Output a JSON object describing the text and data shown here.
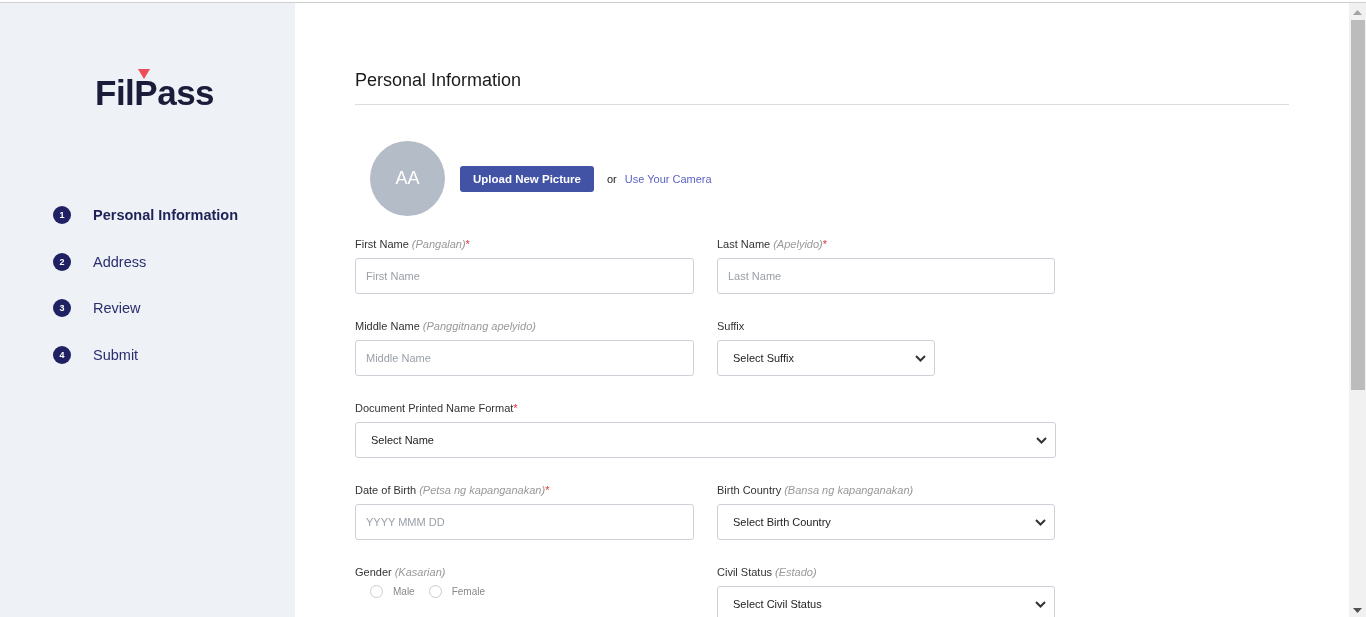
{
  "sidebar": {
    "logo": "FilPass",
    "steps": [
      {
        "number": "1",
        "label": "Personal Information",
        "selected": true
      },
      {
        "number": "2",
        "label": "Address",
        "selected": false
      },
      {
        "number": "3",
        "label": "Review",
        "selected": false
      },
      {
        "number": "4",
        "label": "Submit",
        "selected": false
      }
    ]
  },
  "form": {
    "title": "Personal Information",
    "avatar": {
      "initials": "AA"
    },
    "upload_button": "Upload New Picture",
    "or_text": "or",
    "camera_link": "Use Your Camera",
    "rows": [
      {
        "fields": [
          {
            "kind": "text",
            "label": "First Name",
            "hint": "(Pangalan)",
            "required_mark": "*",
            "placeholder": "First Name"
          },
          {
            "kind": "text",
            "label": "Last Name",
            "hint": "(Apelyido)",
            "required_mark": "*",
            "placeholder": "Last Name"
          }
        ]
      },
      {
        "fields": [
          {
            "kind": "text",
            "label": "Middle Name",
            "hint": "(Panggitnang apelyido)",
            "placeholder": "Middle Name"
          },
          {
            "kind": "select",
            "label": "Suffix",
            "value": "Select Suffix"
          }
        ]
      },
      {
        "fields": [
          {
            "kind": "select",
            "label": "Document Printed Name Format",
            "required_mark": "*",
            "value": "Select Name"
          }
        ]
      },
      {
        "fields": [
          {
            "kind": "text",
            "label": "Date of Birth",
            "hint": "(Petsa ng kapanganakan)",
            "required_mark": "*",
            "placeholder": "YYYY MMM DD"
          },
          {
            "kind": "select",
            "label": "Birth Country",
            "hint": "(Bansa ng kapanganakan)",
            "value": "Select Birth Country"
          }
        ]
      },
      {
        "fields": [
          {
            "kind": "radio",
            "label": "Gender",
            "hint": "(Kasarian)",
            "options": [
              {
                "label": "Male",
                "selected": false
              },
              {
                "label": "Female",
                "selected": false
              }
            ]
          },
          {
            "kind": "select",
            "label": "Civil Status",
            "hint": "(Estado)",
            "value": "Select Civil Status"
          }
        ]
      }
    ]
  }
}
